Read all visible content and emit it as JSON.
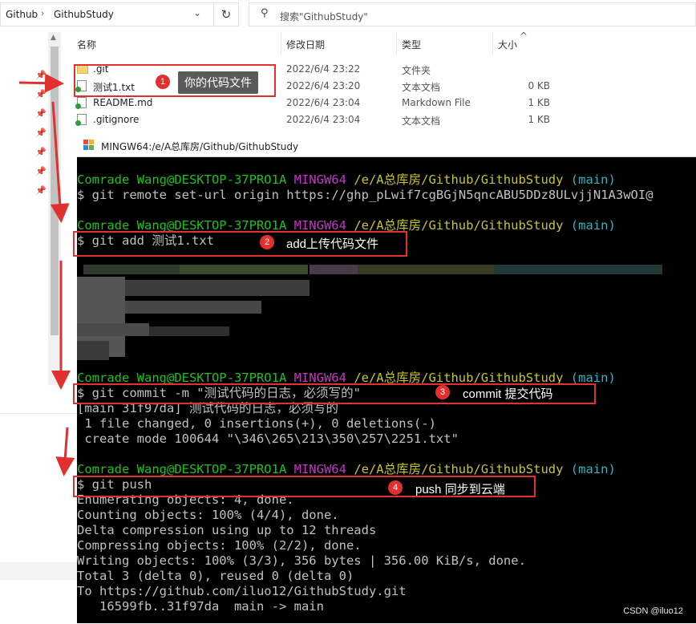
{
  "explorer": {
    "breadcrumb": [
      "Github",
      "GithubStudy"
    ],
    "search_placeholder": "搜索\"GithubStudy\"",
    "columns": {
      "name": "名称",
      "date": "修改日期",
      "type": "类型",
      "size": "大小"
    },
    "files": [
      {
        "name": ".git",
        "date": "2022/6/4 23:22",
        "type": "文件夹",
        "size": "",
        "icon": "folder-icon"
      },
      {
        "name": "测试1.txt",
        "date": "2022/6/4 23:20",
        "type": "文本文档",
        "size": "0 KB",
        "icon": "text-file-icon"
      },
      {
        "name": "README.md",
        "date": "2022/6/4 23:04",
        "type": "Markdown File",
        "size": "1 KB",
        "icon": "markdown-file-icon"
      },
      {
        "name": ".gitignore",
        "date": "2022/6/4 23:04",
        "type": "文本文档",
        "size": "1 KB",
        "icon": "text-file-icon"
      }
    ]
  },
  "terminal": {
    "title": "MINGW64:/e/A总库房/Github/GithubStudy",
    "prompt": {
      "user": "Comrade Wang@DESKTOP-37PRO1A",
      "env": "MINGW64",
      "path": "/e/A总库房/Github/GithubStudy",
      "branch": "(main)"
    },
    "cmd_remote": "$ git remote set-url origin https://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@",
    "cmd_add": "$ git add 测试1.txt",
    "cmd_commit": "$ git commit -m \"测试代码的日志，必须写的\"",
    "commit_out": [
      "[main 31f97da] 测试代码的日志，必须写的",
      " 1 file changed, 0 insertions(+), 0 deletions(-)",
      " create mode 100644 \"\\346\\265\\213\\350\\257\\2251.txt\""
    ],
    "cmd_push": "$ git push",
    "push_out": [
      "Enumerating objects: 4, done.",
      "Counting objects: 100% (4/4), done.",
      "Delta compression using up to 12 threads",
      "Compressing objects: 100% (2/2), done.",
      "Writing objects: 100% (3/3), 356 bytes | 356.00 KiB/s, done.",
      "Total 3 (delta 0), reused 0 (delta 0)",
      "To https://github.com/iluo12/GithubStudy.git",
      "   16599fb..31f97da  main -> main"
    ]
  },
  "annotations": [
    {
      "num": "1",
      "text": "你的代码文件"
    },
    {
      "num": "2",
      "text": "add上传代码文件"
    },
    {
      "num": "3",
      "text": "commit 提交代码"
    },
    {
      "num": "4",
      "text": "push 同步到云端"
    }
  ],
  "watermark": "CSDN @iluo12",
  "colors": {
    "annotation_red": "#e0302f",
    "prompt_green": "#19c319",
    "prompt_magenta": "#c236c2",
    "prompt_yellow": "#c7c429",
    "prompt_cyan": "#29b4c7"
  }
}
